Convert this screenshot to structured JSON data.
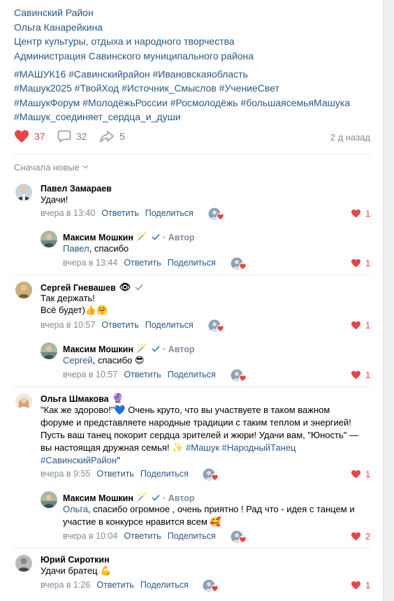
{
  "post": {
    "lines": [
      "Савинский Район",
      "Ольга Канарейкина",
      "Центр культуры, отдыха и народного творчества",
      "Администрация Савинского муниципального района"
    ],
    "hashtags": [
      "#МАШУК16 #Савинскийрайон #Ивановскаяобласть",
      "#Машук2025 #ТвойХод #Источник_Смыслов #УчениеСвет",
      "#МашукФорум #МолодёжьРоссии #Росмолодёжь #большаясемьяМашука",
      "#Машук_соединяет_сердца_и_души"
    ],
    "likes": "37",
    "comments": "32",
    "shares": "5",
    "time_ago": "2 д назад",
    "accent_like": "#e64646",
    "link_color": "#2a5885"
  },
  "sort_label": "Сначала новые",
  "comments": [
    {
      "name": "Павел Замараев",
      "text": [
        "Удачи!"
      ],
      "time": "вчера в 13:40",
      "reply_label": "Ответить",
      "share_label": "Поделиться",
      "likes": "1"
    },
    {
      "name": "Максим Мошкин",
      "author_label": "· Автор",
      "addressee": "Павел",
      "text": [
        ", спасибо"
      ],
      "time": "вчера в 13:44",
      "reply_label": "Ответить",
      "share_label": "Поделиться",
      "likes": "1"
    },
    {
      "name": "Сергей Гневашев",
      "text": [
        "Так держать!",
        "Всё будет)👍🤗"
      ],
      "time": "вчера в 10:57",
      "reply_label": "Ответить",
      "share_label": "Поделиться",
      "likes": "1"
    },
    {
      "name": "Максим Мошкин",
      "author_label": "· Автор",
      "addressee": "Сергей",
      "text": [
        ", спасибо 😎"
      ],
      "time": "вчера в 10:57",
      "reply_label": "Ответить",
      "share_label": "Поделиться",
      "likes": "1"
    },
    {
      "name": "Ольга Шмакова",
      "text": [
        "\"Как же здорово!\"💙 Очень круто, что вы участвуете в таком важном",
        "форуме и представляете народные традиции с таким теплом и энергией!",
        "Пусть ваш танец покорит сердца зрителей и жюри! Удачи вам, \"Юность\" —",
        "вы настоящая дружная семья! ✨ "
      ],
      "tags": "#Машук #НародныйТанец",
      "last_line": "#СавинскийРайон",
      "last_tail": "\"",
      "time": "вчера в 9:55",
      "reply_label": "Ответить",
      "share_label": "Поделиться",
      "likes": "1"
    },
    {
      "name": "Максим Мошкин",
      "author_label": "· Автор",
      "addressee": "Ольга",
      "text": [
        ", спасибо огромное , очень приятно ! Рад что - идея с танцем и",
        "участие в конкурсе нравится всем 🥰"
      ],
      "time": "вчера в 10:04",
      "reply_label": "Ответить",
      "share_label": "Поделиться",
      "likes": "2"
    },
    {
      "name": "Юрий Сироткин",
      "text": [
        "Удачи братец 💪"
      ],
      "time": "вчера в 1:26",
      "reply_label": "Ответить",
      "share_label": "Поделиться",
      "likes": "1"
    }
  ]
}
